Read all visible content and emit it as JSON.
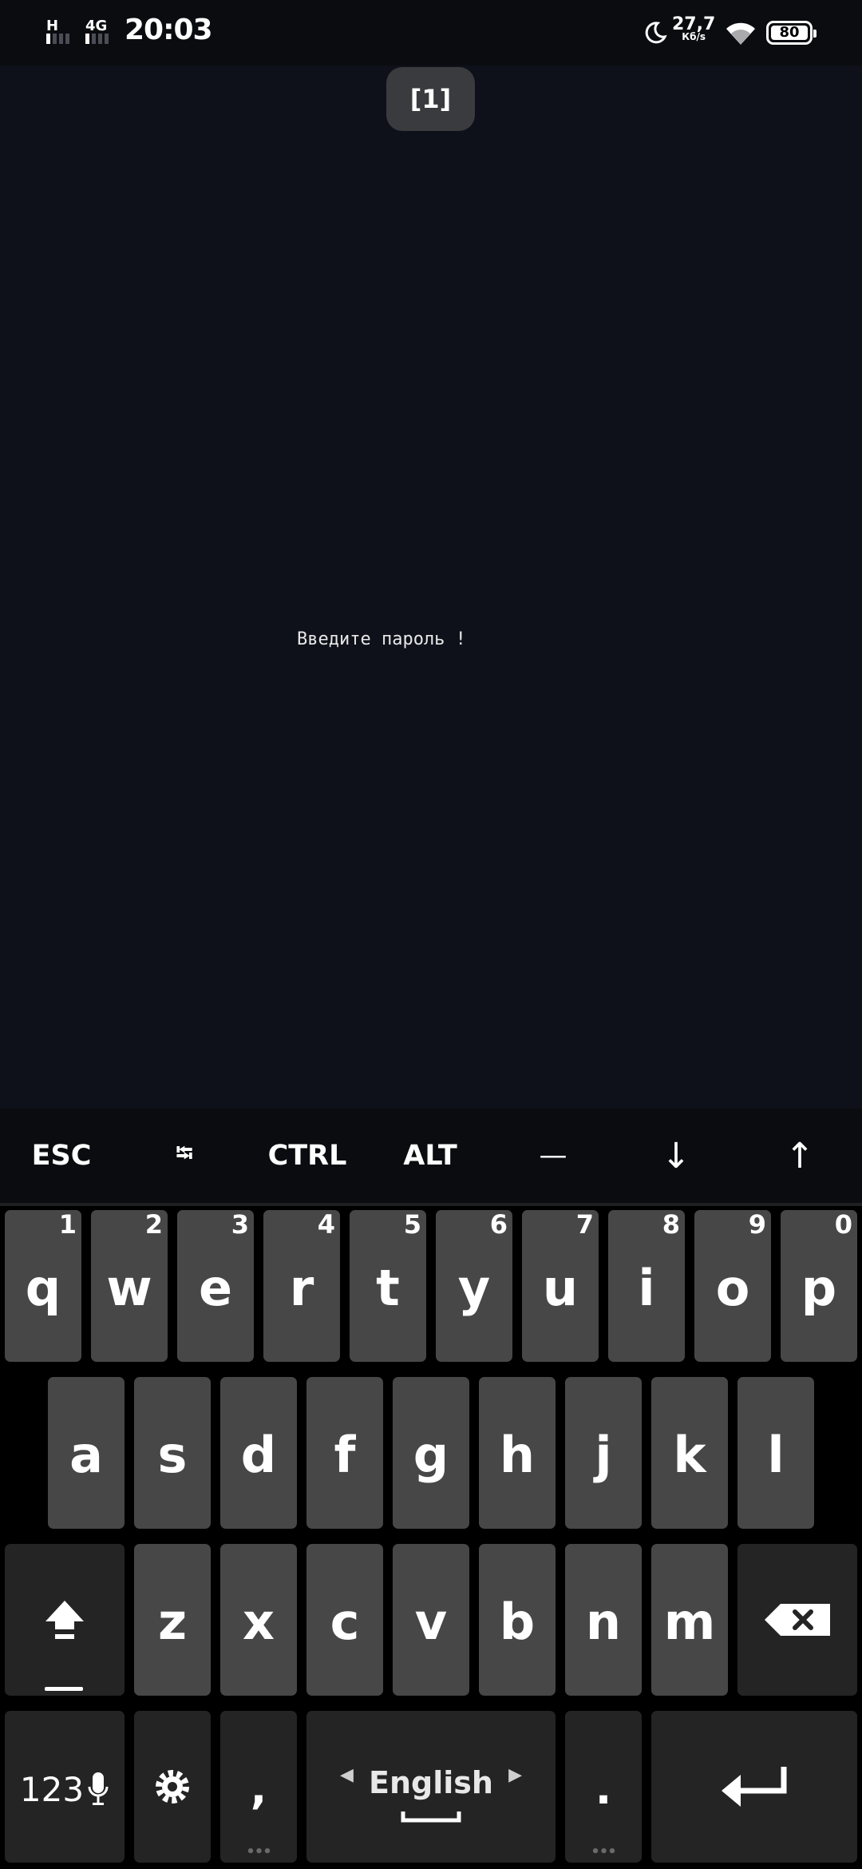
{
  "status_bar": {
    "network_1": "H",
    "network_2": "4G",
    "time": "20:03",
    "speed_value": "27,7",
    "speed_unit": "Кб/s",
    "battery": "80",
    "icons": [
      "signal-icon",
      "moon-icon",
      "wifi-icon",
      "battery-icon"
    ]
  },
  "terminal": {
    "session_label": "[1]",
    "prompt_text": "Введите пароль !"
  },
  "extra_keys": {
    "esc": "ESC",
    "tab": "⭾",
    "ctrl": "CTRL",
    "alt": "ALT",
    "dash": "—",
    "down": "↓",
    "up": "↑"
  },
  "keyboard": {
    "row1": [
      {
        "key": "q",
        "hint": "1"
      },
      {
        "key": "w",
        "hint": "2"
      },
      {
        "key": "e",
        "hint": "3"
      },
      {
        "key": "r",
        "hint": "4"
      },
      {
        "key": "t",
        "hint": "5"
      },
      {
        "key": "y",
        "hint": "6"
      },
      {
        "key": "u",
        "hint": "7"
      },
      {
        "key": "i",
        "hint": "8"
      },
      {
        "key": "o",
        "hint": "9"
      },
      {
        "key": "p",
        "hint": "0"
      }
    ],
    "row2": [
      "a",
      "s",
      "d",
      "f",
      "g",
      "h",
      "j",
      "k",
      "l"
    ],
    "row3": [
      "z",
      "x",
      "c",
      "v",
      "b",
      "n",
      "m"
    ],
    "numbers_label": "123",
    "comma": ",",
    "space_label": "English",
    "period": "."
  },
  "colors": {
    "terminal_bg": "#0e111a",
    "key_light": "#474747",
    "key_dark": "#242424"
  }
}
